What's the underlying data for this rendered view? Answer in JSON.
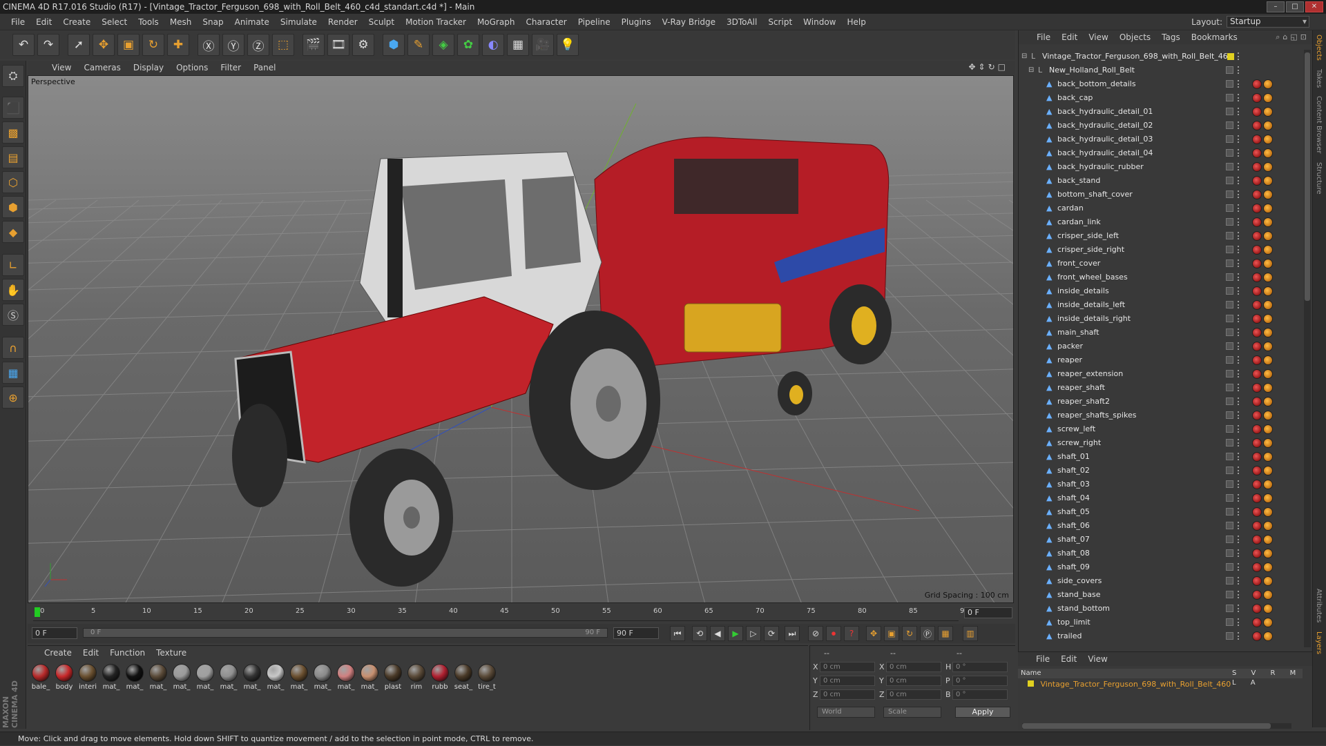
{
  "window": {
    "title": "CINEMA 4D R17.016 Studio (R17) - [Vintage_Tractor_Ferguson_698_with_Roll_Belt_460_c4d_standart.c4d *] - Main"
  },
  "menubar": [
    "File",
    "Edit",
    "Create",
    "Select",
    "Tools",
    "Mesh",
    "Snap",
    "Animate",
    "Simulate",
    "Render",
    "Sculpt",
    "Motion Tracker",
    "MoGraph",
    "Character",
    "Pipeline",
    "Plugins",
    "V-Ray Bridge",
    "3DToAll",
    "Script",
    "Window",
    "Help"
  ],
  "layout": {
    "label": "Layout:",
    "value": "Startup"
  },
  "viewport": {
    "menu": [
      "View",
      "Cameras",
      "Display",
      "Options",
      "Filter",
      "Panel"
    ],
    "label": "Perspective",
    "grid_spacing": "Grid Spacing : 100 cm"
  },
  "timeline": {
    "ticks": [
      "0",
      "5",
      "10",
      "15",
      "20",
      "25",
      "30",
      "35",
      "40",
      "45",
      "50",
      "55",
      "60",
      "65",
      "70",
      "75",
      "80",
      "85",
      "90"
    ],
    "current": "0 F",
    "start": "0 F",
    "slider_left": "0 F",
    "slider_right": "90 F",
    "end": "90 F"
  },
  "materials": {
    "menu": [
      "Create",
      "Edit",
      "Function",
      "Texture"
    ],
    "items": [
      {
        "label": "bale_",
        "color": "#b82a2a"
      },
      {
        "label": "body",
        "color": "#c8282a"
      },
      {
        "label": "interi",
        "color": "#6a5030"
      },
      {
        "label": "mat_",
        "color": "#222"
      },
      {
        "label": "mat_",
        "color": "#111"
      },
      {
        "label": "mat_",
        "color": "#5a4a38"
      },
      {
        "label": "mat_",
        "color": "#9a9a9a"
      },
      {
        "label": "mat_",
        "color": "#a0a0a0"
      },
      {
        "label": "mat_",
        "color": "#909090"
      },
      {
        "label": "mat_",
        "color": "#333"
      },
      {
        "label": "mat_",
        "color": "#c8c8c8"
      },
      {
        "label": "mat_",
        "color": "#6b5030"
      },
      {
        "label": "mat_",
        "color": "#8a8a8a"
      },
      {
        "label": "mat_",
        "color": "#d08080"
      },
      {
        "label": "mat_",
        "color": "#c89070"
      },
      {
        "label": "plast",
        "color": "#4a3a28"
      },
      {
        "label": "rim",
        "color": "#5a4a38"
      },
      {
        "label": "rubb",
        "color": "#b02030"
      },
      {
        "label": "seat_",
        "color": "#4a3a28"
      },
      {
        "label": "tire_t",
        "color": "#5a4a38"
      }
    ]
  },
  "coords": {
    "x": "X",
    "y": "Y",
    "z": "Z",
    "h": "H",
    "p": "P",
    "b": "B",
    "zero_cm": "0 cm",
    "zero_deg": "0 °",
    "world": "World",
    "scale": "Scale",
    "apply": "Apply",
    "top_dashes": "--"
  },
  "objects": {
    "menu": [
      "File",
      "Edit",
      "View",
      "Objects",
      "Tags",
      "Bookmarks"
    ],
    "root": "Vintage_Tractor_Ferguson_698_with_Roll_Belt_460",
    "group": "New_Holland_Roll_Belt",
    "items": [
      "back_bottom_details",
      "back_cap",
      "back_hydraulic_detail_01",
      "back_hydraulic_detail_02",
      "back_hydraulic_detail_03",
      "back_hydraulic_detail_04",
      "back_hydraulic_rubber",
      "back_stand",
      "bottom_shaft_cover",
      "cardan",
      "cardan_link",
      "crisper_side_left",
      "crisper_side_right",
      "front_cover",
      "front_wheel_bases",
      "inside_details",
      "inside_details_left",
      "inside_details_right",
      "main_shaft",
      "packer",
      "reaper",
      "reaper_extension",
      "reaper_shaft",
      "reaper_shaft2",
      "reaper_shafts_spikes",
      "screw_left",
      "screw_right",
      "shaft_01",
      "shaft_02",
      "shaft_03",
      "shaft_04",
      "shaft_05",
      "shaft_06",
      "shaft_07",
      "shaft_08",
      "shaft_09",
      "side_covers",
      "stand_base",
      "stand_bottom",
      "top_limit",
      "trailed"
    ]
  },
  "layers": {
    "menu": [
      "File",
      "Edit",
      "View"
    ],
    "name_header": "Name",
    "cols": "S V R M L A",
    "row": "Vintage_Tractor_Ferguson_698_with_Roll_Belt_460"
  },
  "sidetabs": [
    "Objects",
    "Takes",
    "Content Browser",
    "Structure"
  ],
  "sidetabs_bottom": [
    "Attributes",
    "Layers"
  ],
  "brand": "MAXON CINEMA 4D",
  "status": "Move: Click and drag to move elements. Hold down SHIFT to quantize movement / add to the selection in point mode, CTRL to remove."
}
